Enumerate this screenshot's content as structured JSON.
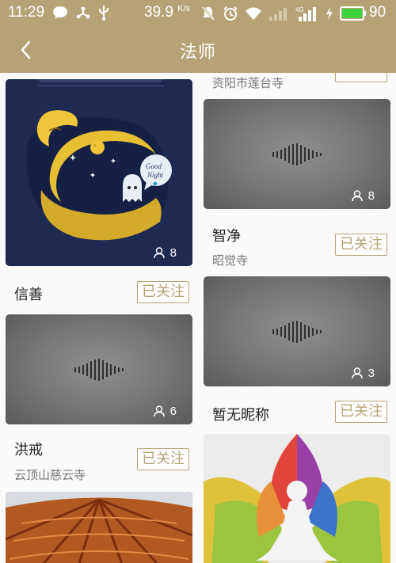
{
  "status": {
    "time": "11:29",
    "speed": "39.9",
    "speed_unit": "K/s",
    "battery": "90"
  },
  "header": {
    "title": "法师"
  },
  "masters": {
    "top_right_location": "资阳市莲台寺",
    "card1_count": "8",
    "card2_count": "8",
    "card3_count": "6",
    "card4_count": "3",
    "m1_name": "信善",
    "m2_name": "智净",
    "m2_location": "昭觉寺",
    "m3_name": "洪戒",
    "m3_location": "云顶山慈云寺",
    "m4_name": "暂无昵称"
  },
  "labels": {
    "followed": "已关注"
  },
  "colors": {
    "brand": "#b7a276",
    "card_dark": "#1f2a52"
  }
}
